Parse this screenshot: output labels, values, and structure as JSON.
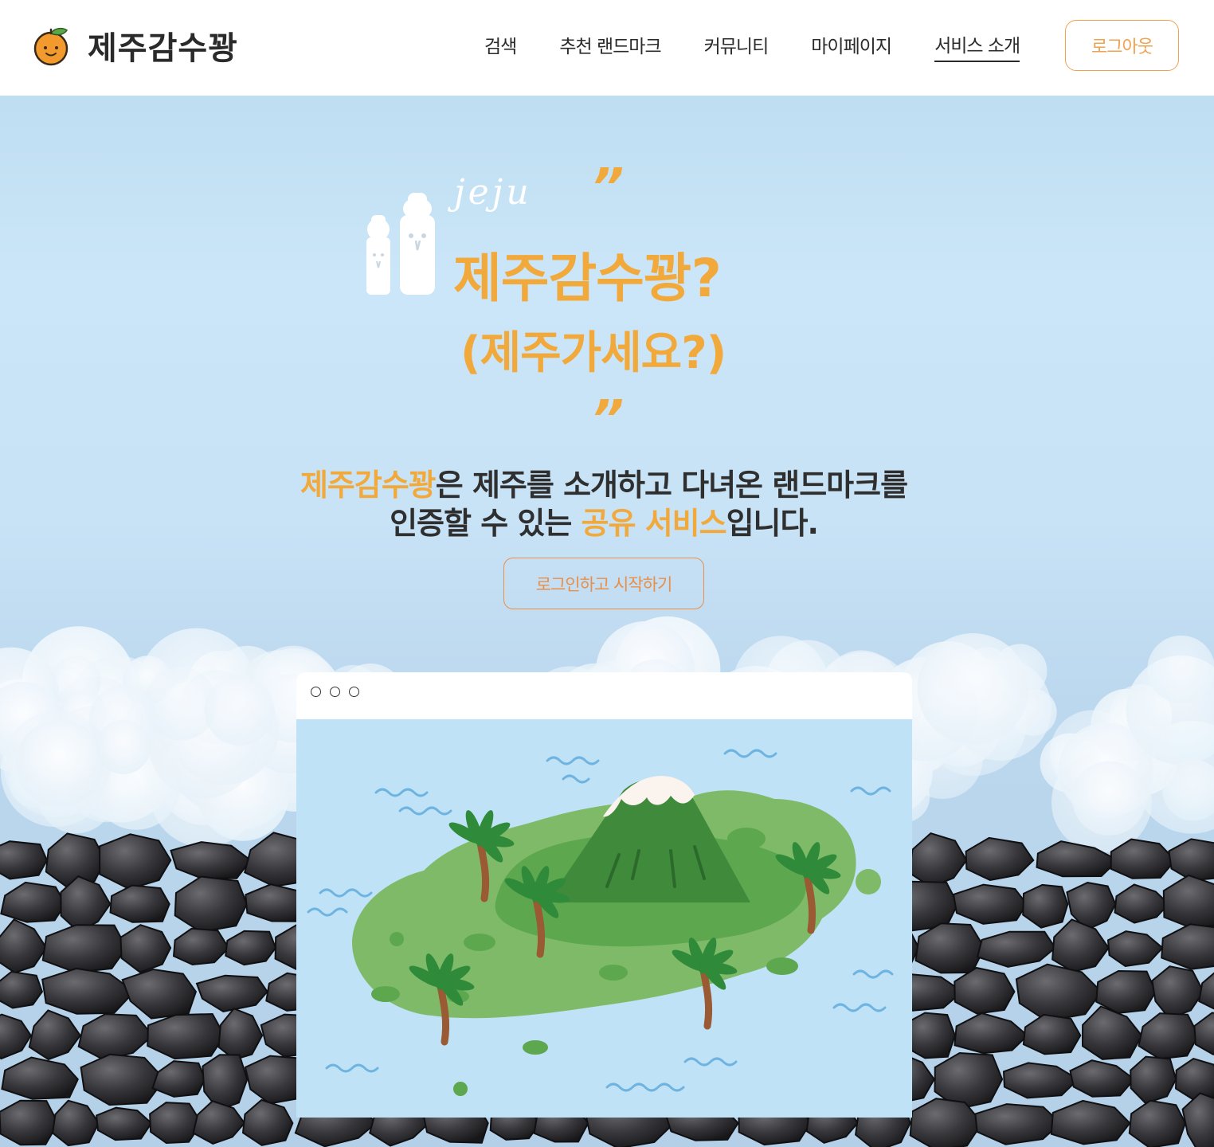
{
  "header": {
    "brand": "제주감수꽝",
    "nav": [
      {
        "label": "검색"
      },
      {
        "label": "추천 랜드마크"
      },
      {
        "label": "커뮤니티"
      },
      {
        "label": "마이페이지"
      },
      {
        "label": "서비스 소개"
      }
    ],
    "active_nav": "서비스 소개",
    "logout_label": "로그아웃"
  },
  "hero": {
    "script_text": "jeju",
    "quote_open": "”",
    "quote_close": "”",
    "title": "제주감수꽝?",
    "subtitle": "(제주가세요?)",
    "description": {
      "brand": "제주감수꽝",
      "line1_rest": "은 제주를 소개하고 다녀온 랜드마크를",
      "line2_start": "인증할 수 있는 ",
      "line2_highlight": "공유 서비스",
      "line2_end": "입니다."
    },
    "start_button_label": "로그인하고 시작하기"
  },
  "theme": {
    "accent": "#f2a93c",
    "button_accent": "#e88f4a",
    "text": "#2f2f2f"
  },
  "icons": [
    "tangerine-logo-icon",
    "moai-icon",
    "window-dot-icon"
  ]
}
